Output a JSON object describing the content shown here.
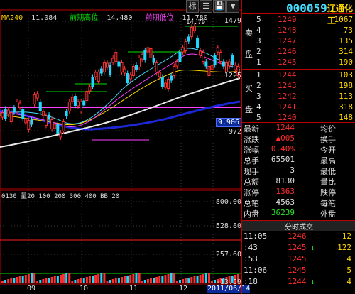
{
  "toolbar": {
    "buttons": [
      "标",
      "☰",
      "💾",
      "▼"
    ]
  },
  "ma_legend": [
    {
      "label": "MA240",
      "value": "11.084",
      "color": "#e0e0e0"
    },
    {
      "label": "前期高位",
      "value": "14.480",
      "color": "#00e000"
    },
    {
      "label": "前期低位",
      "value": "11.780",
      "color": "#ff40ff"
    }
  ],
  "scale": {
    "high_label": "1479",
    "mid_label": "1225",
    "low_label": "972",
    "price_tag": "9.906"
  },
  "annotation": {
    "peak_label": "14.79"
  },
  "volume_scale": {
    "top": "800.00",
    "mid1": "528.80",
    "mid2": "257.60",
    "bottom": "-13.59"
  },
  "volume_legend": [
    {
      "label": "0130",
      "color": "#ffffff"
    },
    {
      "label": "量20",
      "color": "#ffffff"
    },
    {
      "label": "100",
      "color": "#ffffff"
    },
    {
      "label": "200",
      "color": "#ffffff"
    },
    {
      "label": "300",
      "color": "#ffffff"
    },
    {
      "label": "400",
      "color": "#ffffff"
    },
    {
      "label": "BB",
      "color": "#ffffff"
    },
    {
      "label": "20",
      "color": "#ffffff"
    }
  ],
  "x_axis": {
    "labels": [
      "09",
      "10",
      "11",
      "12",
      "2011/06/14"
    ]
  },
  "stock": {
    "code": "000059",
    "name": "辽通化工"
  },
  "asks": {
    "group": "卖盘",
    "rows": [
      {
        "level": "5",
        "price": "1249",
        "vol": "1067"
      },
      {
        "level": "4",
        "price": "1248",
        "vol": "73"
      },
      {
        "level": "3",
        "price": "1247",
        "vol": "135"
      },
      {
        "level": "2",
        "price": "1246",
        "vol": "314"
      },
      {
        "level": "1",
        "price": "1245",
        "vol": "190"
      }
    ]
  },
  "bids": {
    "group": "买盘",
    "rows": [
      {
        "level": "1",
        "price": "1244",
        "vol": "103"
      },
      {
        "level": "2",
        "price": "1243",
        "vol": "198"
      },
      {
        "level": "3",
        "price": "1242",
        "vol": "113"
      },
      {
        "level": "4",
        "price": "1241",
        "vol": "318"
      },
      {
        "level": "5",
        "price": "1240",
        "vol": "148"
      }
    ]
  },
  "quote": [
    {
      "l1": "最新",
      "v1": "1244",
      "c1": "red",
      "l2": "均价",
      "v2": "",
      "c2": "white"
    },
    {
      "l1": "涨跌",
      "v1": "▲005",
      "c1": "red",
      "l2": "换手",
      "v2": "",
      "c2": "white"
    },
    {
      "l1": "涨幅",
      "v1": "0.40%",
      "c1": "red",
      "l2": "今开",
      "v2": "",
      "c2": "white"
    },
    {
      "l1": "总手",
      "v1": "65501",
      "c1": "white",
      "l2": "最高",
      "v2": "",
      "c2": "white"
    },
    {
      "l1": "现手",
      "v1": "3",
      "c1": "white",
      "l2": "最低",
      "v2": "",
      "c2": "white"
    },
    {
      "l1": "总额",
      "v1": "8130",
      "c1": "white",
      "l2": "量比",
      "v2": "",
      "c2": "white"
    },
    {
      "l1": "涨停",
      "v1": "1363",
      "c1": "red",
      "l2": "跌停",
      "v2": "",
      "c2": "white"
    },
    {
      "l1": "总笔",
      "v1": "4563",
      "c1": "white",
      "l2": "每笔",
      "v2": "",
      "c2": "white"
    },
    {
      "l1": "内盘",
      "v1": "36239",
      "c1": "green",
      "l2": "外盘",
      "v2": "",
      "c2": "white"
    }
  ],
  "ticks": {
    "header": "分时成交",
    "rows": [
      {
        "time": "11:05",
        "price": "1246",
        "dir": "",
        "dcolor": "red",
        "vol": "12"
      },
      {
        "time": ":43",
        "price": "1245",
        "dir": "↓",
        "dcolor": "green",
        "vol": "122"
      },
      {
        "time": ":53",
        "price": "1245",
        "dir": "",
        "dcolor": "red",
        "vol": "4"
      },
      {
        "time": "11:06",
        "price": "1245",
        "dir": "",
        "dcolor": "red",
        "vol": "5"
      },
      {
        "time": ":18",
        "price": "1244",
        "dir": "↓",
        "dcolor": "green",
        "vol": "4"
      }
    ]
  }
}
